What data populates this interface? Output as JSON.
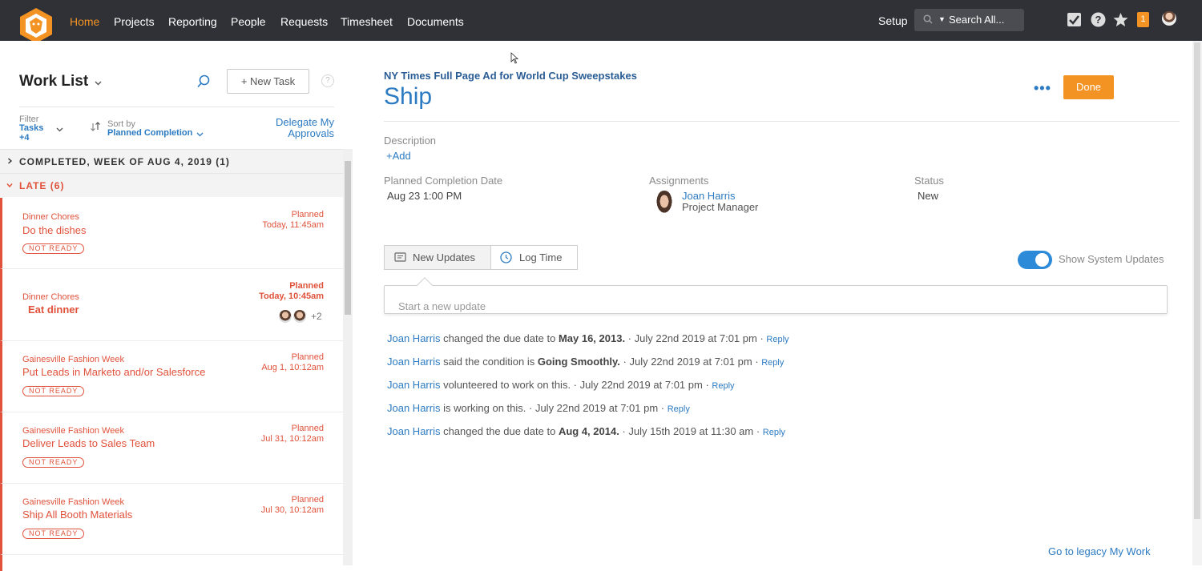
{
  "nav": {
    "items": [
      "Home",
      "Projects",
      "Reporting",
      "People",
      "Requests",
      "Timesheet",
      "Documents"
    ],
    "setup": "Setup",
    "search_label": "Search All...",
    "notification_count": "1",
    "icons": [
      "lion-logo-icon",
      "checkbox-icon",
      "help-icon",
      "star-icon",
      "notification-badge",
      "user-avatar"
    ],
    "colors": {
      "bar": "#2f3137",
      "active": "#f39323"
    }
  },
  "worklist": {
    "title": "Work List",
    "new_task": "+ New Task",
    "help": "?",
    "filter_label": "Filter",
    "filter_value_1": "Tasks",
    "filter_value_2": "+4",
    "sort_label": "Sort by",
    "sort_value": "Planned Completion",
    "delegate_1": "Delegate My",
    "delegate_2": "Approvals",
    "group_completed": "COMPLETED, WEEK OF AUG 4, 2019 (1)",
    "group_late": "LATE (6)",
    "tasks": [
      {
        "project": "Dinner Chores",
        "name": "Do the dishes",
        "status": "NOT READY",
        "planned_label": "Planned",
        "planned": "Today, 11:45am"
      },
      {
        "project": "Dinner Chores",
        "name": "Eat  dinner",
        "planned_label": "Planned",
        "planned": "Today, 10:45am",
        "extra_assignees": "+2"
      },
      {
        "project": "Gainesville Fashion Week",
        "name": "Put Leads in Marketo and/or Salesforce",
        "status": "NOT READY",
        "planned_label": "Planned",
        "planned": "Aug 1, 10:12am"
      },
      {
        "project": "Gainesville Fashion Week",
        "name": "Deliver Leads to Sales Team",
        "status": "NOT READY",
        "planned_label": "Planned",
        "planned": "Jul 31, 10:12am"
      },
      {
        "project": "Gainesville Fashion Week",
        "name": "Ship All Booth Materials",
        "status": "NOT READY",
        "planned_label": "Planned",
        "planned": "Jul 30, 10:12am"
      }
    ],
    "late_color": "#e0523b"
  },
  "detail": {
    "parent": "NY Times Full Page Ad for World Cup Sweepstakes",
    "title": "Ship",
    "more": "•••",
    "done": "Done",
    "description_label": "Description",
    "add": "+Add",
    "planned_label": "Planned Completion Date",
    "planned_value": "Aug 23 1:00 PM",
    "assignments_label": "Assignments",
    "assignee_name": "Joan Harris",
    "assignee_role": "Project Manager",
    "status_label": "Status",
    "status_value": "New",
    "tab_updates": "New Updates",
    "tab_log": "Log Time",
    "show_system": "Show System Updates",
    "update_placeholder": "Start a new update",
    "feed": [
      {
        "who": "Joan Harris",
        "pre": " changed the due date to ",
        "bold": "May 16, 2013.",
        "post": " · July 22nd 2019 at 7:01 pm · ",
        "reply": "Reply"
      },
      {
        "who": "Joan Harris",
        "pre": " said the condition is ",
        "bold": "Going Smoothly.",
        "post": " · July 22nd 2019 at 7:01 pm · ",
        "reply": "Reply"
      },
      {
        "who": "Joan Harris",
        "pre": " volunteered to work on this. · July 22nd 2019 at 7:01 pm · ",
        "bold": "",
        "post": "",
        "reply": "Reply"
      },
      {
        "who": "Joan Harris",
        "pre": " is working on this. · July 22nd 2019 at 7:01 pm · ",
        "bold": "",
        "post": "",
        "reply": "Reply"
      },
      {
        "who": "Joan Harris",
        "pre": " changed the due date to ",
        "bold": "Aug 4, 2014.",
        "post": " · July 15th 2019 at 11:30 am · ",
        "reply": "Reply"
      }
    ],
    "legacy_link": "Go to legacy My Work",
    "accent": "#2c7bc2",
    "done_color": "#f39323"
  }
}
